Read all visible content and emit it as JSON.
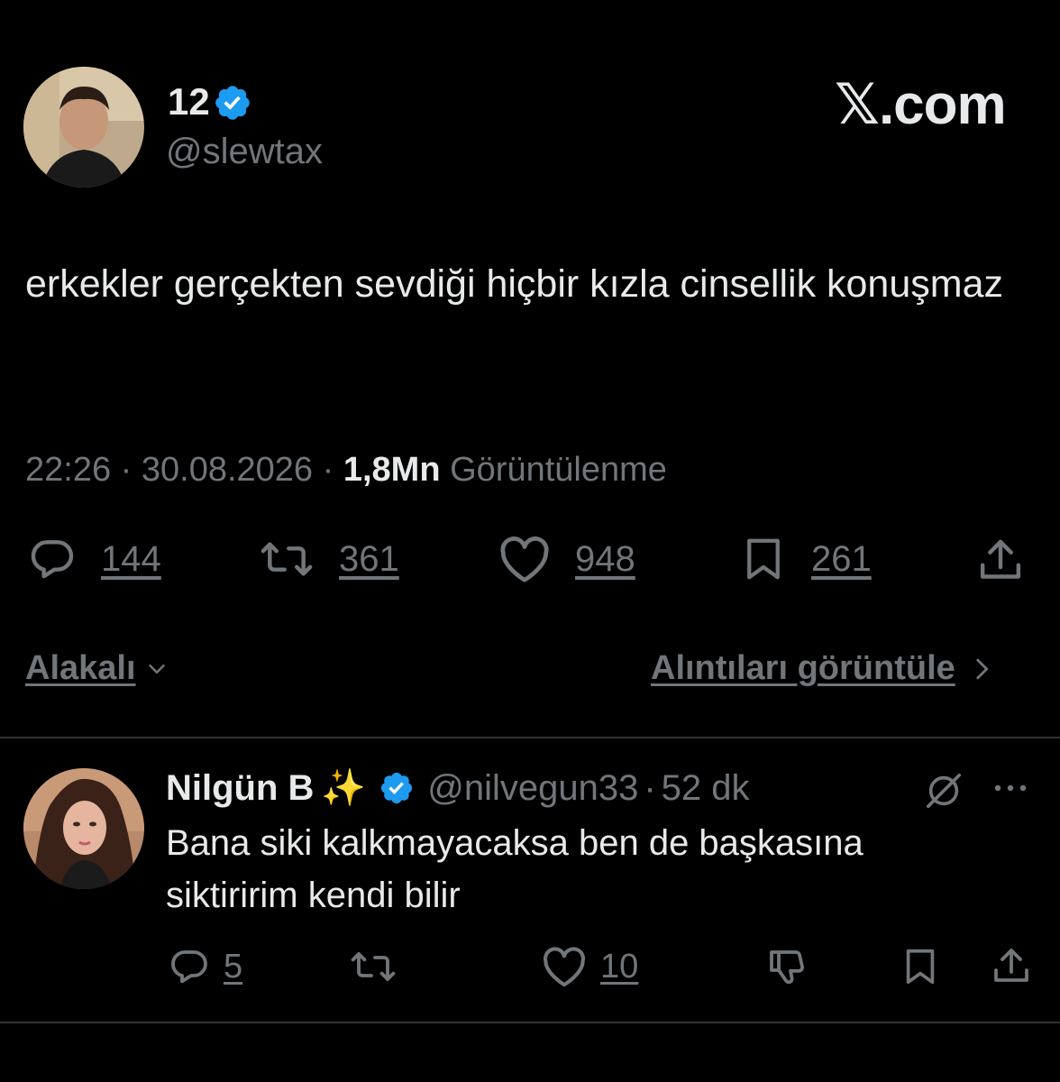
{
  "brand": {
    "label": "𝕏.com"
  },
  "tweet": {
    "author_name": "12",
    "author_handle": "@slewtax",
    "text": "erkekler gerçekten sevdiği hiçbir kızla cinsellik konuşmaz",
    "time": "22:26",
    "date": "30.08.2026",
    "views_count": "1,8Mn",
    "views_label": "Görüntülenme",
    "separator": "·",
    "replies": "144",
    "retweets": "361",
    "likes": "948",
    "bookmarks": "261"
  },
  "sort": {
    "label": "Alakalı"
  },
  "quotes": {
    "label": "Alıntıları görüntüle"
  },
  "reply": {
    "author_name": "Nilgün B",
    "author_emoji": "✨",
    "author_handle": "@nilvegun33",
    "separator": "·",
    "age": "52 dk",
    "text": "Bana siki kalkmayacaksa ben de başkasına siktiririm kendi bilir",
    "replies": "5",
    "likes": "10"
  },
  "colors": {
    "background": "#000000",
    "text_primary": "#e7e9ea",
    "text_secondary": "#71767b",
    "verified": "#1d9bf0",
    "divider": "#2f3336"
  }
}
